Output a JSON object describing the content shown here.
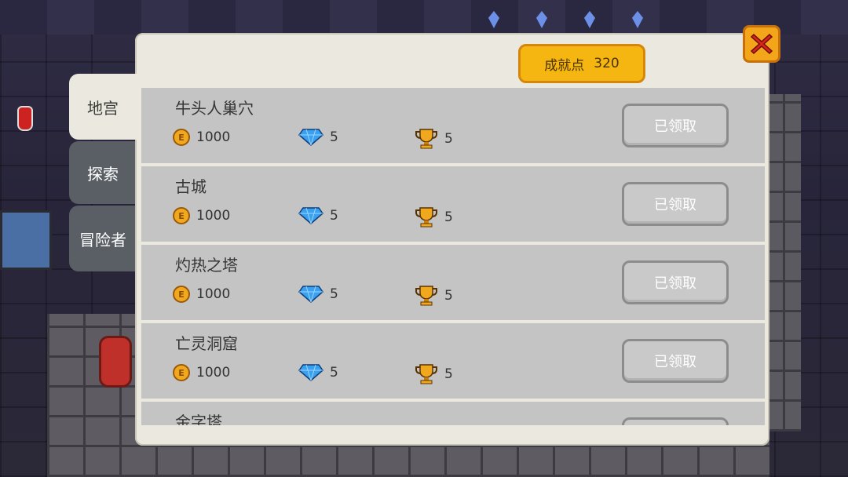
{
  "tabs": [
    {
      "label": "地宫",
      "active": true
    },
    {
      "label": "探索",
      "active": false
    },
    {
      "label": "冒险者",
      "active": false
    }
  ],
  "header": {
    "points_label": "成就点",
    "points_value": "320"
  },
  "achievements": [
    {
      "name": "牛头人巢穴",
      "coins": "1000",
      "gems": "5",
      "trophies": "5",
      "button": "已领取"
    },
    {
      "name": "古城",
      "coins": "1000",
      "gems": "5",
      "trophies": "5",
      "button": "已领取"
    },
    {
      "name": "灼热之塔",
      "coins": "1000",
      "gems": "5",
      "trophies": "5",
      "button": "已领取"
    },
    {
      "name": "亡灵洞窟",
      "coins": "1000",
      "gems": "5",
      "trophies": "5",
      "button": "已领取"
    },
    {
      "name": "金字塔",
      "coins": "",
      "gems": "",
      "trophies": "",
      "button": ""
    }
  ],
  "icons": {
    "coin": "coin-icon",
    "gem": "diamond-icon",
    "trophy": "trophy-icon",
    "close": "close-icon"
  },
  "colors": {
    "badge": "#f6b612",
    "close": "#f3a61a",
    "close_x": "#d8241a",
    "panel": "#ebe9df",
    "row": "#c4c4c4"
  }
}
